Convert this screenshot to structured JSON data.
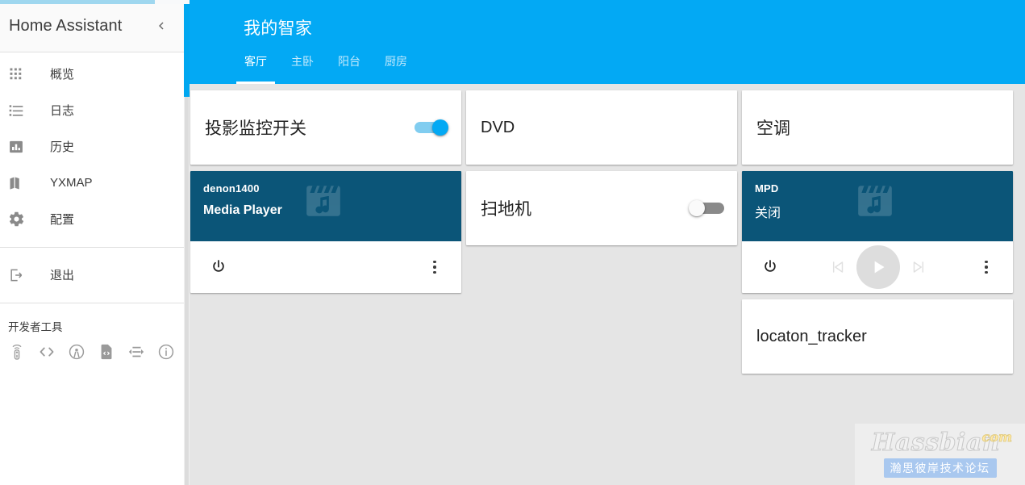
{
  "sidebar": {
    "title": "Home Assistant",
    "collapse_icon": "chevron-left-icon",
    "items": [
      {
        "label": "概览",
        "icon": "grid-apps-icon"
      },
      {
        "label": "日志",
        "icon": "list-bullet-icon"
      },
      {
        "label": "历史",
        "icon": "bar-chart-icon"
      },
      {
        "label": "YXMAP",
        "icon": "map-icon"
      },
      {
        "label": "配置",
        "icon": "gear-icon"
      },
      {
        "label": "退出",
        "icon": "logout-icon"
      }
    ],
    "devtools_title": "开发者工具",
    "devtools_icons": [
      "remote-control-icon",
      "code-brackets-icon",
      "broadcast-antenna-icon",
      "file-code-icon",
      "template-arrows-icon",
      "info-circle-icon"
    ]
  },
  "toolbar": {
    "view_title": "我的智家",
    "accent_color": "#03a9f4",
    "tabs": [
      {
        "label": "客厅",
        "active": true
      },
      {
        "label": "主卧",
        "active": false
      },
      {
        "label": "阳台",
        "active": false
      },
      {
        "label": "厨房",
        "active": false
      }
    ]
  },
  "cards": {
    "col1": {
      "entity": {
        "name": "投影监控开关",
        "toggle_state": "on"
      },
      "media_player": {
        "title": "denon1400",
        "state": "Media Player",
        "art_icon": "movie-music-icon",
        "power_icon": "power-icon",
        "menu_icon": "more-vertical-icon",
        "banner_color": "#0b5578"
      }
    },
    "col2": {
      "entity_dvd": {
        "name": "DVD"
      },
      "entity_vacuum": {
        "name": "扫地机",
        "toggle_state": "off"
      }
    },
    "col3": {
      "entity_ac": {
        "name": "空调"
      },
      "media_player": {
        "title": "MPD",
        "state": "关闭",
        "art_icon": "movie-music-icon",
        "power_icon": "power-icon",
        "prev_icon": "skip-previous-icon",
        "play_icon": "play-icon",
        "next_icon": "skip-next-icon",
        "menu_icon": "more-vertical-icon",
        "banner_color": "#0b5578"
      },
      "entity_tracker": {
        "name": "locaton_tracker"
      }
    }
  },
  "watermark": {
    "brand": "Hassbian",
    "tld": "com",
    "subtitle": "瀚思彼岸技术论坛"
  }
}
